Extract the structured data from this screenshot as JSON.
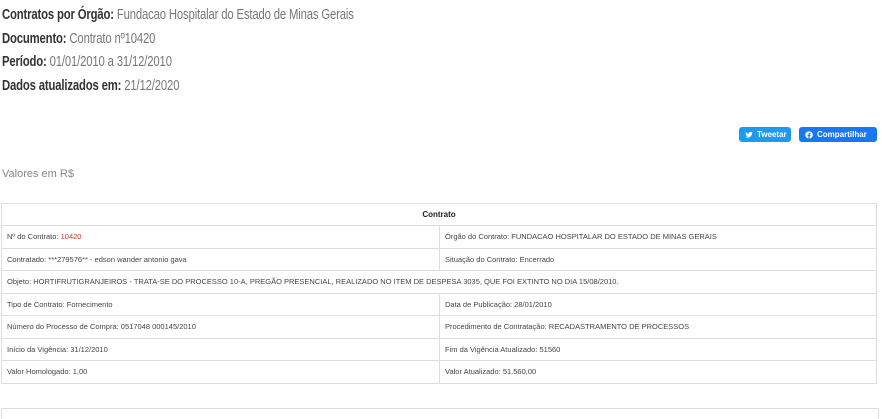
{
  "header": {
    "orgao_key": "Contratos por Órgão:",
    "orgao_value": "Fundacao Hospitalar do Estado de Minas Gerais",
    "documento_key": "Documento:",
    "documento_value": "Contrato nº10420",
    "periodo_key": "Período:",
    "periodo_value": "01/01/2010 a 31/12/2010",
    "atualizados_key": "Dados atualizados em:",
    "atualizados_value": "21/12/2020"
  },
  "share": {
    "tweet_label": "Tweetar",
    "fb_label": "Compartilhar",
    "tweet_icon": "twitter-bird-icon",
    "fb_icon": "facebook-icon",
    "tweet_color": "#1d9bf0",
    "fb_color": "#1877f2"
  },
  "values_note": "Valores em R$",
  "table": {
    "title": "Contrato",
    "numero_label": "Nº do Contrato:",
    "numero_value": "10420",
    "orgao": "Órgão do Contrato: FUNDACAO HOSPITALAR DO ESTADO DE MINAS GERAIS",
    "contratado": "Contratado: ***279576** - edson wander antonio gava",
    "situacao": "Situação do Contrato: Encerrado",
    "objeto": "Objeto: HORTIFRUTIGRANJEIROS - TRATA-SE DO PROCESSO 10-A, PREGÃO PRESENCIAL, REALIZADO NO ITEM DE DESPESA 3035, QUE FOI EXTINTO NO DIA 15/08/2010.",
    "tipo": "Tipo de Contrato: Fornecimento",
    "publicacao": "Data de Publicação: 28/01/2010",
    "processo": "Número do Processo de Compra: 0517048 000145/2010",
    "procedimento": "Procedimento de Contratação: RECADASTRAMENTO DE PROCESSOS",
    "inicio": "Início da Vigência: 31/12/2010",
    "fim": "Fim da Vigência Atualizado: 51560",
    "homologado": "Valor Homologado: 1,00",
    "atualizado": "Valor Atualizado: 51.560,00"
  }
}
